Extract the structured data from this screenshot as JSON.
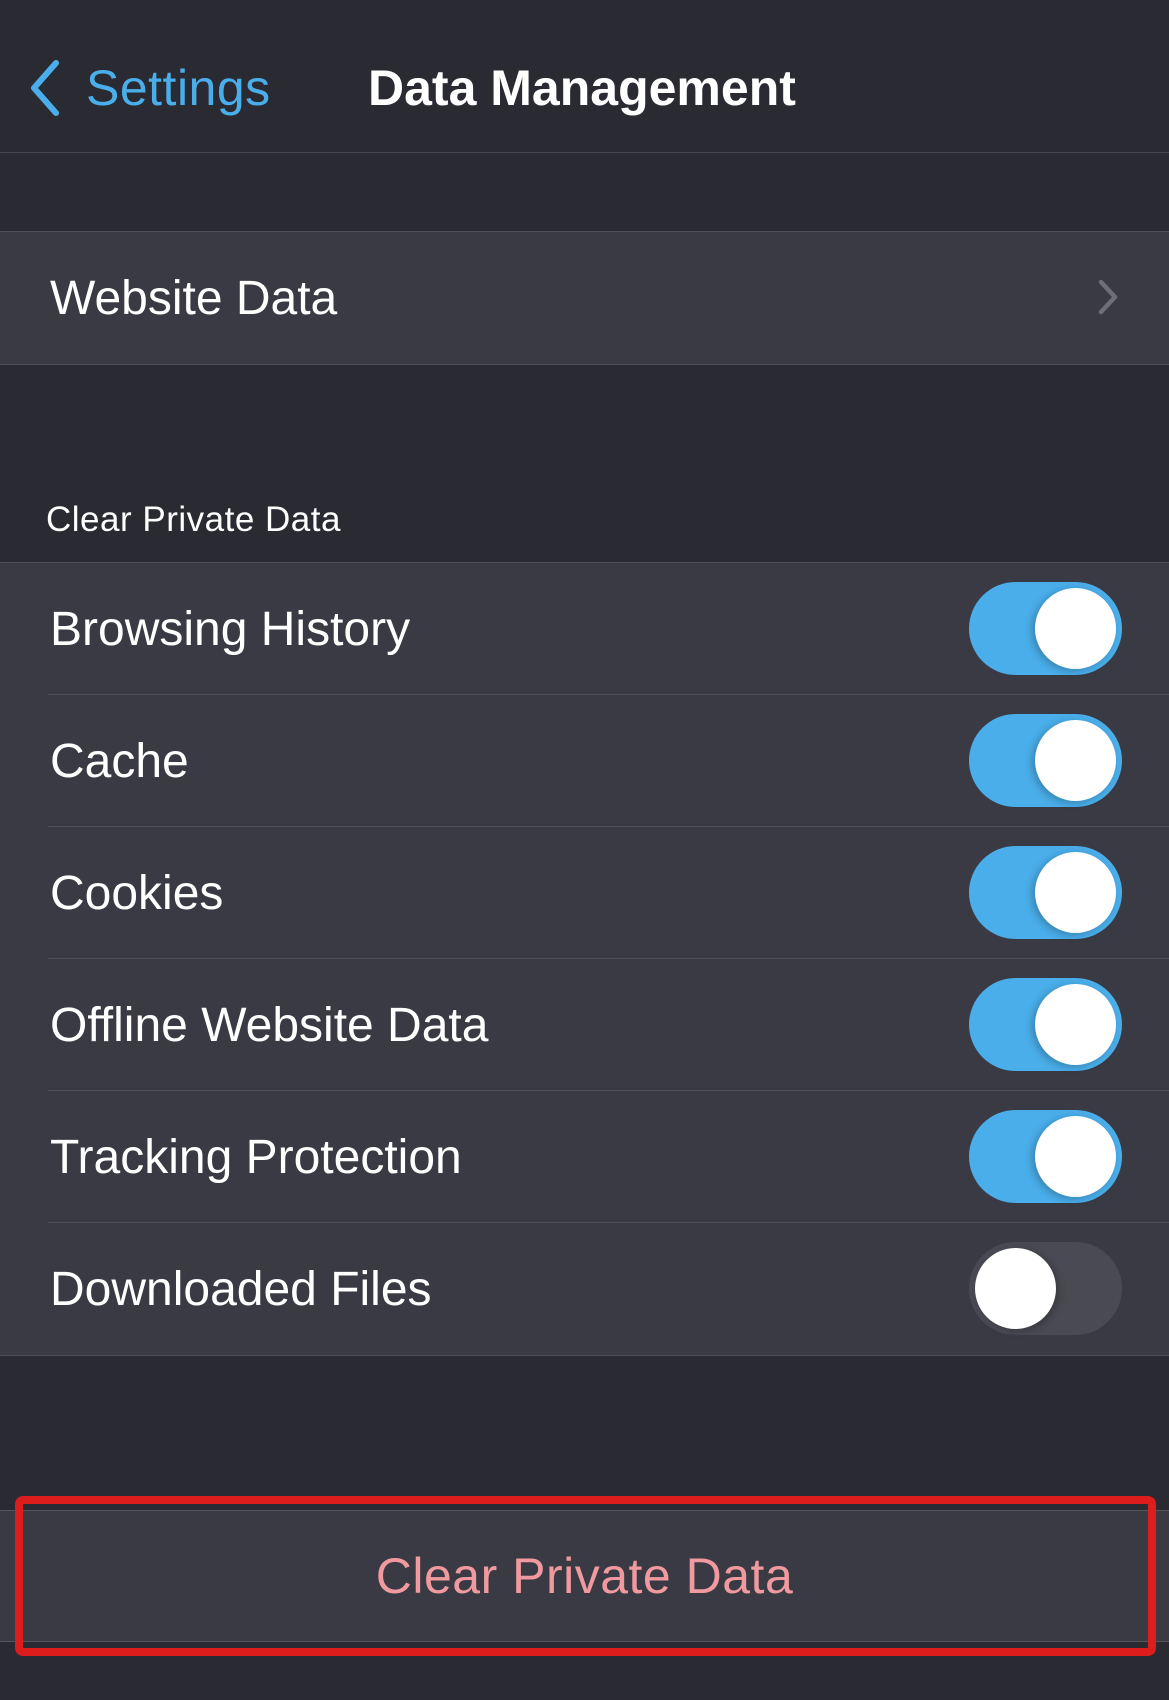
{
  "navbar": {
    "back_label": "Settings",
    "back_icon": "chevron-left-icon",
    "title": "Data Management"
  },
  "website_data": {
    "label": "Website Data",
    "icon": "chevron-right-icon"
  },
  "clear_section": {
    "header": "Clear Private Data",
    "items": [
      {
        "label": "Browsing History",
        "enabled": true
      },
      {
        "label": "Cache",
        "enabled": true
      },
      {
        "label": "Cookies",
        "enabled": true
      },
      {
        "label": "Offline Website Data",
        "enabled": true
      },
      {
        "label": "Tracking Protection",
        "enabled": true
      },
      {
        "label": "Downloaded Files",
        "enabled": false
      }
    ]
  },
  "clear_button": {
    "label": "Clear Private Data",
    "highlighted": true
  },
  "colors": {
    "accent": "#4aaeea",
    "destructive_text": "#f09aa0",
    "highlight_outline": "#dd1c1c",
    "background": "#2a2a33",
    "cell_background": "#3a3a44",
    "toggle_off": "#4a4a54"
  }
}
